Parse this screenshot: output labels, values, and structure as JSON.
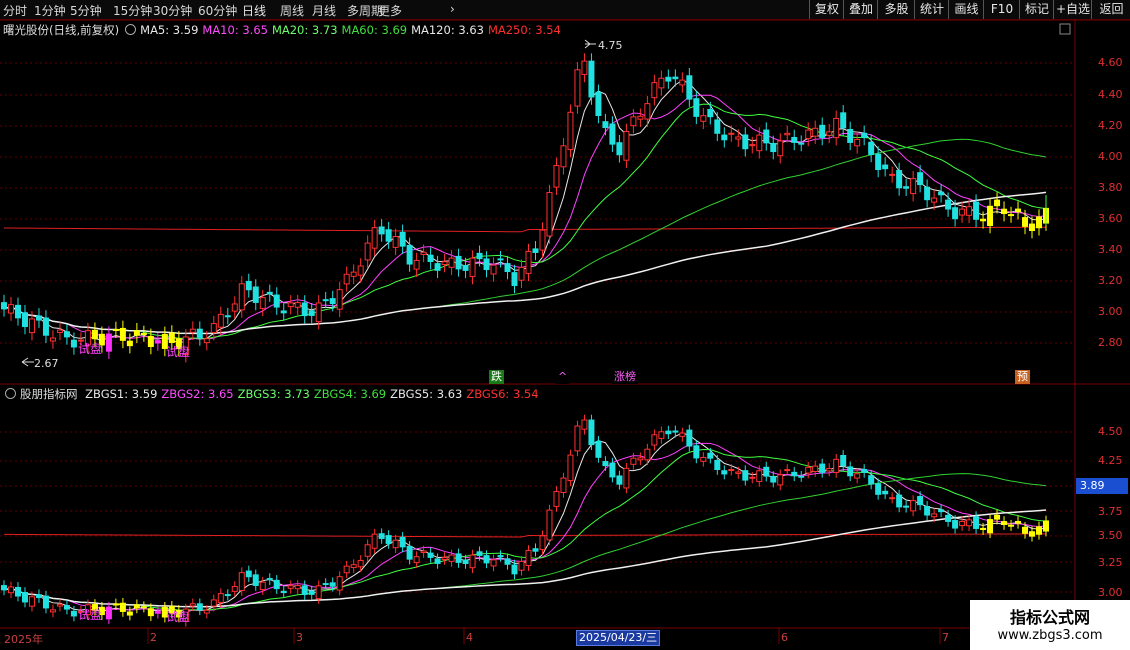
{
  "toolbar": {
    "timeframes": [
      "分时",
      "1分钟",
      "5分钟",
      "15分钟",
      "30分钟",
      "60分钟",
      "日线",
      "周线",
      "月线",
      "多周期",
      "更多"
    ],
    "active": "日线",
    "right_buttons": [
      "复权",
      "叠加",
      "多股",
      "统计",
      "画线",
      "F10",
      "标记",
      "+自选",
      "返回"
    ]
  },
  "main_panel": {
    "title": "曙光股份(日线,前复权)",
    "ma_legend": [
      {
        "label": "MA5: 3.59",
        "color": "#e8e8e8"
      },
      {
        "label": "MA10: 3.65",
        "color": "#ff4cff"
      },
      {
        "label": "MA20: 3.73",
        "color": "#6cff6c"
      },
      {
        "label": "MA60: 3.69",
        "color": "#40e040"
      },
      {
        "label": "MA120: 3.63",
        "color": "#e8e8e8"
      },
      {
        "label": "MA250: 3.54",
        "color": "#ff3030"
      }
    ],
    "axis_ticks": [
      "4.60",
      "4.40",
      "4.20",
      "4.00",
      "3.80",
      "3.60",
      "3.40",
      "3.20",
      "3.00",
      "2.80"
    ],
    "high_label": "4.75",
    "low_label": "2.67",
    "signal_labels": [
      "试盘",
      "试盘"
    ],
    "events": [
      {
        "text": "跌",
        "color": "#ffffff",
        "bg": "#1a7a1a"
      },
      {
        "text": "^",
        "color": "#ff60ff",
        "bg": "#000000"
      },
      {
        "text": "涨榜",
        "color": "#ff60ff",
        "bg": "#000000"
      },
      {
        "text": "预",
        "color": "#ffffff",
        "bg": "#c86020"
      }
    ]
  },
  "sub_panel": {
    "title": "股朋指标网",
    "legend": [
      {
        "label": "ZBGS1: 3.59",
        "color": "#e8e8e8"
      },
      {
        "label": "ZBGS2: 3.65",
        "color": "#ff4cff"
      },
      {
        "label": "ZBGS3: 3.73",
        "color": "#6cff6c"
      },
      {
        "label": "ZBGS4: 3.69",
        "color": "#40e040"
      },
      {
        "label": "ZBGS5: 3.63",
        "color": "#e8e8e8"
      },
      {
        "label": "ZBGS6: 3.54",
        "color": "#ff3030"
      }
    ],
    "axis_ticks": [
      "4.50",
      "4.25",
      "3.75",
      "3.50",
      "3.25",
      "3.00"
    ],
    "current_price": "3.89",
    "signal_labels": [
      "试盘",
      "试盘"
    ]
  },
  "date_axis": {
    "labels": [
      "2025年",
      "2",
      "3",
      "4",
      "6",
      "7"
    ],
    "selected": "2025/04/23/三"
  },
  "watermark": {
    "line1": "指标公式网",
    "line2": "www.zbgs3.com"
  },
  "colors": {
    "up": "#ff3030",
    "down": "#20e0e0",
    "yellow": "#ffff00",
    "magenta": "#ff30ff",
    "grid": "#600000"
  },
  "chart_data": {
    "type": "candlestick",
    "approx_ohlc_sequence": "Daily bars Jan–Jul 2025 rising from ~2.7 to a 4.75 high (late April) then settling near 3.6",
    "high": 4.75,
    "low": 2.67
  }
}
